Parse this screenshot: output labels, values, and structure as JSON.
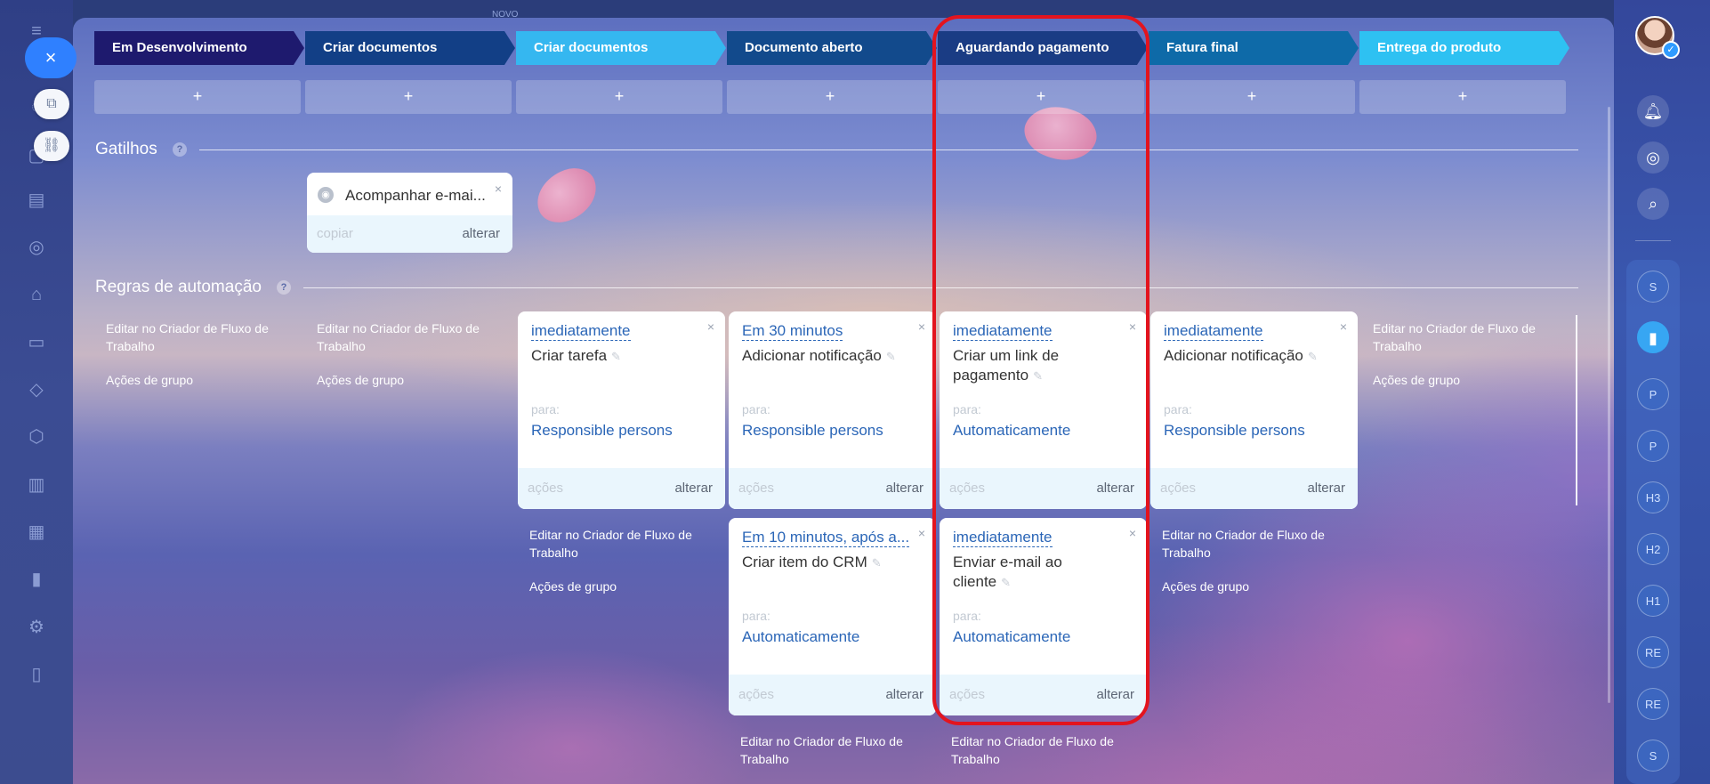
{
  "topbar": {
    "novo_label": "NOVO"
  },
  "nav": {
    "close_icon": "×"
  },
  "stages": [
    {
      "name": "Em Desenvolvimento",
      "color": "#1e1a6e"
    },
    {
      "name": "Criar documentos",
      "color": "#123f86"
    },
    {
      "name": "Criar documentos",
      "color": "#35b7f0"
    },
    {
      "name": "Documento aberto",
      "color": "#124a8c"
    },
    {
      "name": "Aguardando pagamento",
      "color": "#1a3c84"
    },
    {
      "name": "Fatura final",
      "color": "#0e6aa8"
    },
    {
      "name": "Entrega do produto",
      "color": "#2ec1f2"
    }
  ],
  "add_button": "+",
  "triggers": {
    "title": "Gatilhos",
    "help": "?",
    "card": {
      "title": "Acompanhar e-mai...",
      "copy": "copiar",
      "change": "alterar",
      "close": "×"
    }
  },
  "automation": {
    "title": "Regras de automação",
    "help": "?",
    "edit_link": "Editar no Criador de Fluxo de Trabalho",
    "group_link": "Ações de grupo",
    "to_label": "para:",
    "actions_label": "ações",
    "change_label": "alterar",
    "close": "×",
    "pencil": "✎",
    "cards": [
      {
        "when": "imediatamente",
        "action": "Criar tarefa",
        "to": "Responsible persons"
      },
      {
        "when": "Em 30 minutos",
        "action": "Adicionar notificação",
        "to": "Responsible persons"
      },
      {
        "when": "imediatamente",
        "action": "Criar um link de pagamento",
        "to": "Automaticamente"
      },
      {
        "when": "imediatamente",
        "action": "Adicionar notificação",
        "to": "Responsible persons"
      },
      {
        "when": "Em 10 minutos, após a...",
        "action": "Criar item do CRM",
        "to": "Automaticamente"
      },
      {
        "when": "imediatamente",
        "action": "Enviar e-mail ao cliente",
        "to": "Automaticamente"
      }
    ]
  },
  "right_rail": {
    "chats": [
      "S",
      "",
      "P",
      "P",
      "H3",
      "H2",
      "H1",
      "RE",
      "RE",
      "S"
    ]
  }
}
